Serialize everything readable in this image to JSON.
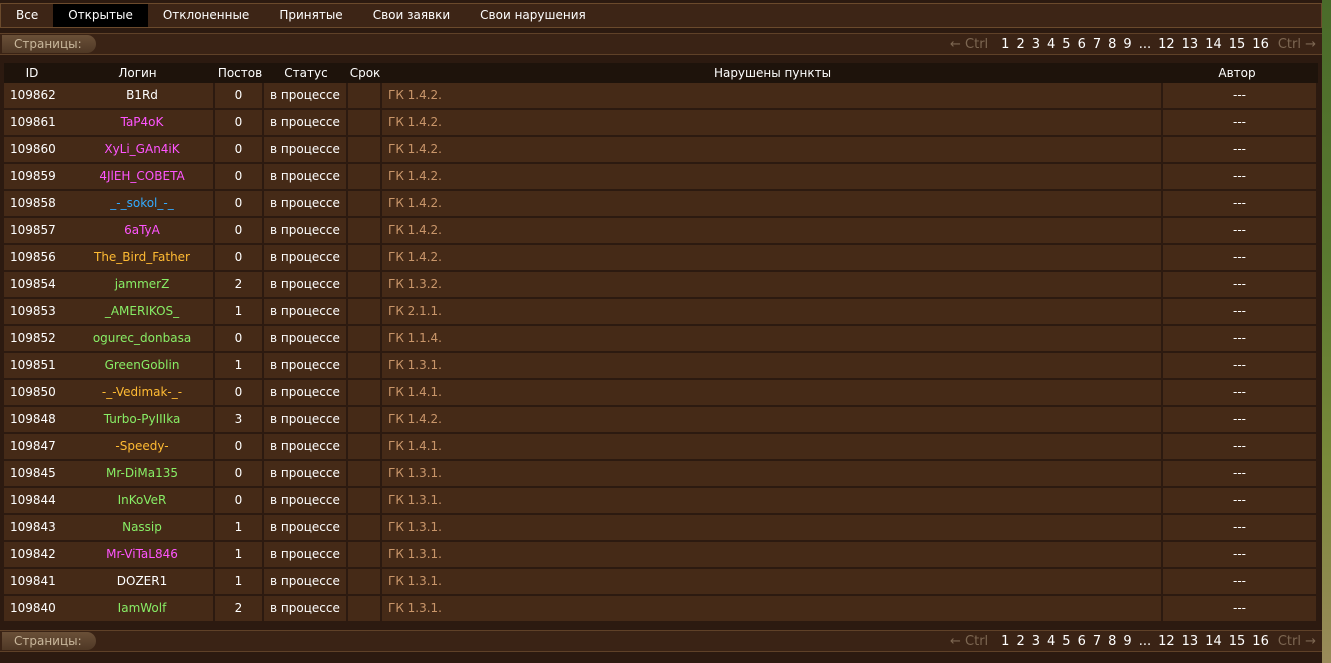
{
  "tabs": [
    {
      "label": "Все",
      "active": false
    },
    {
      "label": "Открытые",
      "active": true
    },
    {
      "label": "Отклоненные",
      "active": false
    },
    {
      "label": "Принятые",
      "active": false
    },
    {
      "label": "Свои заявки",
      "active": false
    },
    {
      "label": "Свои нарушения",
      "active": false
    }
  ],
  "pager": {
    "label": "Страницы:",
    "prev": "← Ctrl",
    "next": "Ctrl →",
    "pages": [
      "1",
      "2",
      "3",
      "4",
      "5",
      "6",
      "7",
      "8",
      "9",
      "...",
      "12",
      "13",
      "14",
      "15",
      "16"
    ]
  },
  "columns": {
    "id": "ID",
    "login": "Логин",
    "posts": "Постов",
    "status": "Статус",
    "term": "Срок",
    "violations": "Нарушены пункты",
    "author": "Автор"
  },
  "colors": {
    "white": "#ffffff",
    "pink": "#ff55ff",
    "blue": "#33aaff",
    "orange": "#ffbb33",
    "green": "#88ee66",
    "violation": "#c9966a"
  },
  "rows": [
    {
      "id": "109862",
      "login": "B1Rd",
      "login_color": "#ffffff",
      "posts": "0",
      "status": "в процессе",
      "term": "",
      "violations": "ГК 1.4.2.",
      "author": "---"
    },
    {
      "id": "109861",
      "login": "TaP4oK",
      "login_color": "#ff55ff",
      "posts": "0",
      "status": "в процессе",
      "term": "",
      "violations": "ГК 1.4.2.",
      "author": "---"
    },
    {
      "id": "109860",
      "login": "XyLi_GAn4iK",
      "login_color": "#ff55ff",
      "posts": "0",
      "status": "в процессе",
      "term": "",
      "violations": "ГК 1.4.2.",
      "author": "---"
    },
    {
      "id": "109859",
      "login": "4JlEH_COBETA",
      "login_color": "#ff55ff",
      "posts": "0",
      "status": "в процессе",
      "term": "",
      "violations": "ГК 1.4.2.",
      "author": "---"
    },
    {
      "id": "109858",
      "login": "_-_sokol_-_",
      "login_color": "#33aaff",
      "posts": "0",
      "status": "в процессе",
      "term": "",
      "violations": "ГК 1.4.2.",
      "author": "---"
    },
    {
      "id": "109857",
      "login": "6aTyA",
      "login_color": "#ff55ff",
      "posts": "0",
      "status": "в процессе",
      "term": "",
      "violations": "ГК 1.4.2.",
      "author": "---"
    },
    {
      "id": "109856",
      "login": "The_Bird_Father",
      "login_color": "#ffbb33",
      "posts": "0",
      "status": "в процессе",
      "term": "",
      "violations": "ГК 1.4.2.",
      "author": "---"
    },
    {
      "id": "109854",
      "login": "jammerZ",
      "login_color": "#88ee66",
      "posts": "2",
      "status": "в процессе",
      "term": "",
      "violations": "ГК 1.3.2.",
      "author": "---"
    },
    {
      "id": "109853",
      "login": "_AMERIKOS_",
      "login_color": "#88ee66",
      "posts": "1",
      "status": "в процессе",
      "term": "",
      "violations": "ГК 2.1.1.",
      "author": "---"
    },
    {
      "id": "109852",
      "login": "ogurec_donbasa",
      "login_color": "#88ee66",
      "posts": "0",
      "status": "в процессе",
      "term": "",
      "violations": "ГК 1.1.4.",
      "author": "---"
    },
    {
      "id": "109851",
      "login": "GreenGoblin",
      "login_color": "#88ee66",
      "posts": "1",
      "status": "в процессе",
      "term": "",
      "violations": "ГК 1.3.1.",
      "author": "---"
    },
    {
      "id": "109850",
      "login": "-_-Vedimak-_-",
      "login_color": "#ffbb33",
      "posts": "0",
      "status": "в процессе",
      "term": "",
      "violations": "ГК 1.4.1.",
      "author": "---"
    },
    {
      "id": "109848",
      "login": "Turbo-PyIIIka",
      "login_color": "#88ee66",
      "posts": "3",
      "status": "в процессе",
      "term": "",
      "violations": "ГК 1.4.2.",
      "author": "---"
    },
    {
      "id": "109847",
      "login": "-Speedy-",
      "login_color": "#ffbb33",
      "posts": "0",
      "status": "в процессе",
      "term": "",
      "violations": "ГК 1.4.1.",
      "author": "---"
    },
    {
      "id": "109845",
      "login": "Mr-DiMa135",
      "login_color": "#88ee66",
      "posts": "0",
      "status": "в процессе",
      "term": "",
      "violations": "ГК 1.3.1.",
      "author": "---"
    },
    {
      "id": "109844",
      "login": "InKoVeR",
      "login_color": "#88ee66",
      "posts": "0",
      "status": "в процессе",
      "term": "",
      "violations": "ГК 1.3.1.",
      "author": "---"
    },
    {
      "id": "109843",
      "login": "Nassip",
      "login_color": "#88ee66",
      "posts": "1",
      "status": "в процессе",
      "term": "",
      "violations": "ГК 1.3.1.",
      "author": "---"
    },
    {
      "id": "109842",
      "login": "Mr-ViTaL846",
      "login_color": "#ff55ff",
      "posts": "1",
      "status": "в процессе",
      "term": "",
      "violations": "ГК 1.3.1.",
      "author": "---"
    },
    {
      "id": "109841",
      "login": "DOZER1",
      "login_color": "#ffffff",
      "posts": "1",
      "status": "в процессе",
      "term": "",
      "violations": "ГК 1.3.1.",
      "author": "---"
    },
    {
      "id": "109840",
      "login": "IamWolf",
      "login_color": "#88ee66",
      "posts": "2",
      "status": "в процессе",
      "term": "",
      "violations": "ГК 1.3.1.",
      "author": "---"
    }
  ]
}
